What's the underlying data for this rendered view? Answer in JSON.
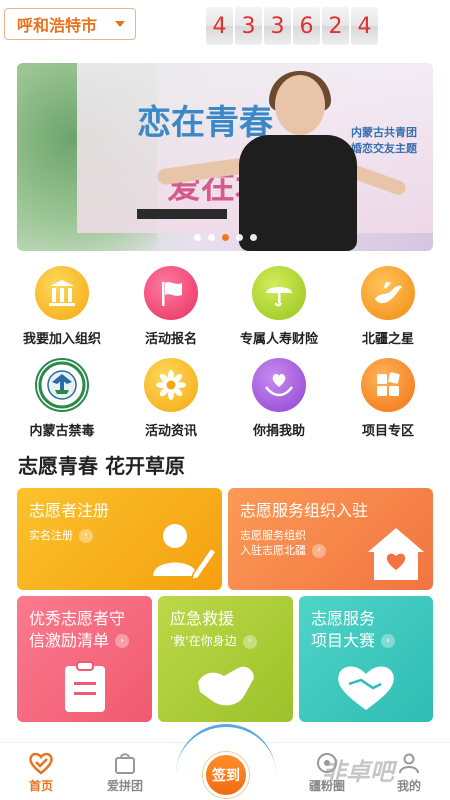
{
  "header": {
    "city": "呼和浩特市",
    "counter_digits": [
      "4",
      "3",
      "3",
      "6",
      "2",
      "4"
    ]
  },
  "banner": {
    "slogan_line1": "恋在青春",
    "slogan_line2": "爱在北疆",
    "right_text_line1": "内蒙古共青团",
    "right_text_line2": "婚恋交友主题",
    "slide_count": 5,
    "active_slide": 3
  },
  "grid": [
    {
      "label": "我要加入组织",
      "icon": "building-icon",
      "color": "#f5b21c"
    },
    {
      "label": "活动报名",
      "icon": "flag-icon",
      "color": "#f0467a"
    },
    {
      "label": "专属人寿财险",
      "icon": "umbrella-icon",
      "color": "#a5d22a"
    },
    {
      "label": "北疆之星",
      "icon": "dove-hand-icon",
      "color": "#f5a21c"
    },
    {
      "label": "内蒙古禁毒",
      "icon": "anti-drug-emblem-icon",
      "color": "#2a8a4a"
    },
    {
      "label": "活动资讯",
      "icon": "flower-icon",
      "color": "#f8b81c"
    },
    {
      "label": "你捐我助",
      "icon": "heart-hands-icon",
      "color": "#a05ad8"
    },
    {
      "label": "项目专区",
      "icon": "grid-blocks-icon",
      "color": "#f5821c"
    }
  ],
  "section_title": "志愿青春 花开草原",
  "cards": {
    "volunteer_register": {
      "title": "志愿者注册",
      "sub": "实名注册",
      "color": "#f8b220"
    },
    "org_join": {
      "title": "志愿服务组织入驻",
      "sub_line1": "志愿服务组织",
      "sub_line2": "入驻志愿北疆",
      "color": "#f7844a"
    },
    "excellent": {
      "title_line1": "优秀志愿者守",
      "title_line2": "信激励清单",
      "color": "#f5667c"
    },
    "emergency": {
      "title": "应急救援",
      "sub": "'救'在你身边",
      "color": "#a8cc3a"
    },
    "contest": {
      "title_line1": "志愿服务",
      "title_line2": "项目大赛",
      "color": "#3ec8c0"
    }
  },
  "bottom_nav": {
    "home": "首页",
    "group": "爱拼团",
    "checkin": "签到",
    "fans": "疆粉圈",
    "mine": "我的"
  },
  "watermark": "非卓吧"
}
